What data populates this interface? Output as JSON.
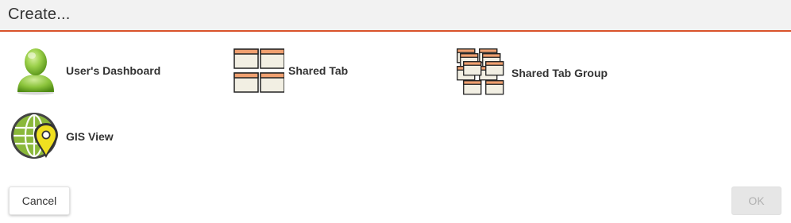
{
  "dialog": {
    "title": "Create..."
  },
  "options": [
    {
      "label": "User's Dashboard",
      "icon": "user-icon"
    },
    {
      "label": "Shared Tab",
      "icon": "shared-tab-icon"
    },
    {
      "label": "Shared Tab Group",
      "icon": "shared-tab-group-icon"
    },
    {
      "label": "GIS View",
      "icon": "gis-globe-pin-icon"
    }
  ],
  "buttons": {
    "cancel": "Cancel",
    "ok": "OK",
    "ok_disabled": true
  },
  "colors": {
    "header_bg": "#f2f2f2",
    "header_border": "#d9532b",
    "user_icon_green": "#8cc43c",
    "tab_orange": "#f0a070",
    "tab_body": "#f2efe3",
    "globe_green": "#8ab83a",
    "pin_yellow": "#f0e020"
  }
}
